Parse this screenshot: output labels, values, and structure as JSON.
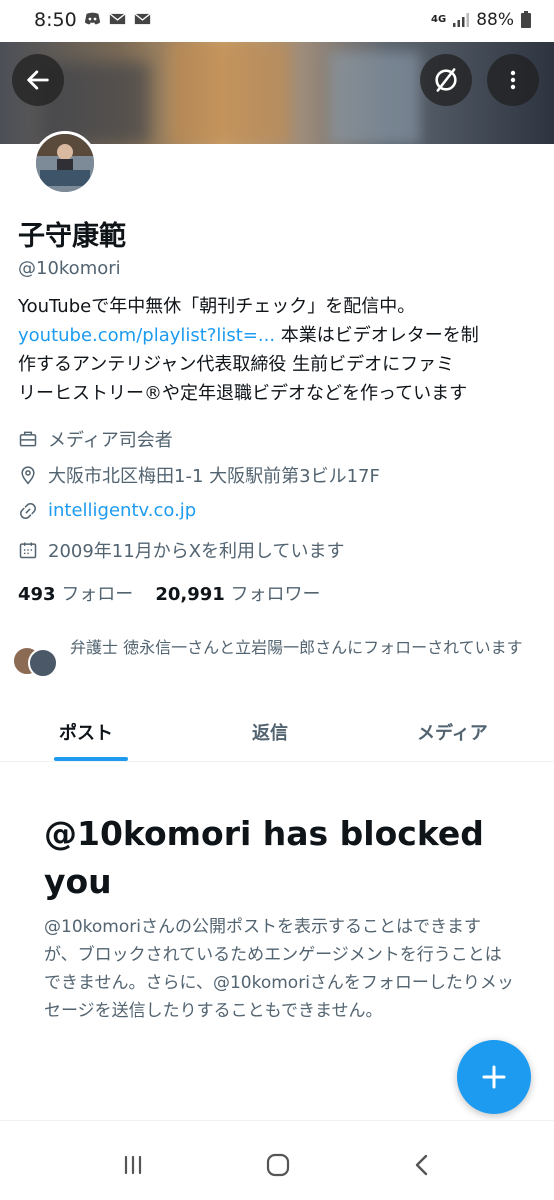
{
  "status_bar": {
    "time": "8:50",
    "network": "4G",
    "battery": "88%",
    "icons": [
      "discord-icon",
      "mail-icon",
      "mail-icon",
      "signal-icon",
      "battery-icon"
    ]
  },
  "profile": {
    "display_name": "子守康範",
    "handle": "@10komori",
    "bio_line1": "YouTubeで年中無休「朝刊チェック」を配信中。",
    "bio_link": "youtube.com/playlist?list=...",
    "bio_rest_1": " 本業はビデオレターを制",
    "bio_line3": "作するアンテリジャン代表取締役 生前ビデオにファミ",
    "bio_line4": "リーヒストリー®や定年退職ビデオなどを作っています",
    "job": "メディア司会者",
    "location": "大阪市北区梅田1-1 大阪駅前第3ビル17F",
    "website": "intelligentv.co.jp",
    "joined": "2009年11月からXを利用しています",
    "following_count": "493",
    "following_label": "フォロー",
    "followers_count": "20,991",
    "followers_label": "フォロワー",
    "followed_by": "弁護士 徳永信一さんと立岩陽一郎さんにフォローされています"
  },
  "tabs": [
    {
      "label": "ポスト",
      "active": true
    },
    {
      "label": "返信",
      "active": false
    },
    {
      "label": "メディア",
      "active": false
    }
  ],
  "blocked": {
    "title": "@10komori has blocked you",
    "description": "@10komoriさんの公開ポストを表示することはできますが、ブロックされているためエンゲージメントを行うことはできません。さらに、@10komoriさんをフォローしたりメッセージを送信したりすることもできません。"
  },
  "colors": {
    "accent": "#1d9bf0",
    "text_primary": "#0f1419",
    "text_secondary": "#536471"
  }
}
